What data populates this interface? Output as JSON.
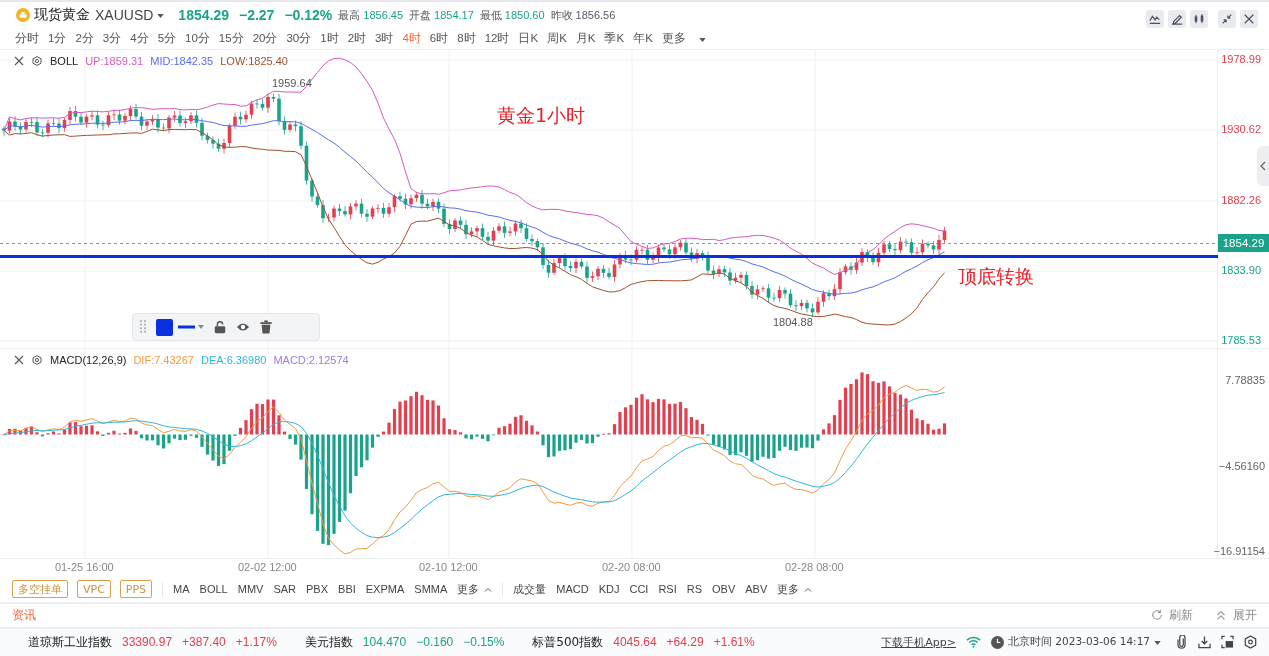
{
  "header": {
    "title": "现货黄金",
    "symbol": "XAUUSD",
    "color": "#1aa38a",
    "price": "1854.29",
    "change": "−2.27",
    "change_pct": "−0.12%",
    "stats": [
      {
        "label": "最高",
        "value": "1856.45",
        "color": "#1aa38a"
      },
      {
        "label": "开盘",
        "value": "1854.17",
        "color": "#1aa38a"
      },
      {
        "label": "最低",
        "value": "1850.60",
        "color": "#1aa38a"
      },
      {
        "label": "昨收",
        "value": "1856.56",
        "color": "#555a66"
      }
    ]
  },
  "timeframes": [
    {
      "label": "分时",
      "selected": false
    },
    {
      "label": "1分",
      "selected": false
    },
    {
      "label": "2分",
      "selected": false
    },
    {
      "label": "3分",
      "selected": false
    },
    {
      "label": "4分",
      "selected": false
    },
    {
      "label": "5分",
      "selected": false
    },
    {
      "label": "10分",
      "selected": false
    },
    {
      "label": "15分",
      "selected": false
    },
    {
      "label": "20分",
      "selected": false
    },
    {
      "label": "30分",
      "selected": false
    },
    {
      "label": "1时",
      "selected": false
    },
    {
      "label": "2时",
      "selected": false
    },
    {
      "label": "3时",
      "selected": false
    },
    {
      "label": "4时",
      "selected": true
    },
    {
      "label": "6时",
      "selected": false
    },
    {
      "label": "8时",
      "selected": false
    },
    {
      "label": "12时",
      "selected": false
    },
    {
      "label": "日K",
      "selected": false
    },
    {
      "label": "周K",
      "selected": false
    },
    {
      "label": "月K",
      "selected": false
    },
    {
      "label": "季K",
      "selected": false
    },
    {
      "label": "年K",
      "selected": false
    }
  ],
  "timeframes_more": "更多",
  "main_pane": {
    "indicator": "BOLL",
    "values": [
      {
        "label": "UP:1859.31",
        "color": "#d45bc0"
      },
      {
        "label": "MID:1842.35",
        "color": "#5b6cf0"
      },
      {
        "label": "LOW:1825.40",
        "color": "#a0522d"
      }
    ],
    "y_axis": [
      {
        "label": "1978.99",
        "color": "#e04050"
      },
      {
        "label": "1930.62",
        "color": "#e04050"
      },
      {
        "label": "1882.26",
        "color": "#e04050"
      },
      {
        "label": "1833.90",
        "color": "#1aa38a"
      },
      {
        "label": "1785.53",
        "color": "#1aa38a"
      }
    ],
    "current_price": "1854.29",
    "high_marker": "1959.64",
    "low_marker": "1804.88",
    "annotations": [
      "黄金1小时",
      "顶底转换"
    ]
  },
  "macd_pane": {
    "indicator": "MACD(12,26,9)",
    "values": [
      {
        "label": "DIF:7.43267",
        "color": "#f39a3c"
      },
      {
        "label": "DEA:6.36980",
        "color": "#2fb6d6"
      },
      {
        "label": "MACD:2.12574",
        "color": "#9b7be0"
      }
    ],
    "y_axis": [
      "7.78835",
      "−4.56160",
      "−16.91154"
    ]
  },
  "x_axis": [
    "01-25 16:00",
    "02-02 12:00",
    "02-10 12:00",
    "02-20 08:00",
    "02-28 08:00"
  ],
  "tools": [
    "多空挂单",
    "VPC",
    "PPS"
  ],
  "main_indicators": [
    "MA",
    "BOLL",
    "MMV",
    "SAR",
    "PBX",
    "BBI",
    "EXPMA",
    "SMMA"
  ],
  "main_more": "更多",
  "sub_indicators": [
    "成交量",
    "MACD",
    "KDJ",
    "CCI",
    "RSI",
    "RS",
    "OBV",
    "ABV"
  ],
  "sub_more": "更多",
  "news": {
    "title": "资讯",
    "refresh": "刷新",
    "expand": "展开"
  },
  "ticker": [
    {
      "name": "道琼斯工业指数",
      "value": "33390.97",
      "change": "+387.40",
      "pct": "+1.17%",
      "color": "#e04050"
    },
    {
      "name": "美元指数",
      "value": "104.470",
      "change": "−0.160",
      "pct": "−0.15%",
      "color": "#1aa38a"
    },
    {
      "name": "标普500指数",
      "value": "4045.64",
      "change": "+64.29",
      "pct": "+1.61%",
      "color": "#e04050"
    }
  ],
  "download": "下载手机App>",
  "clock": "北京时间 2023-03-06 14:17"
}
